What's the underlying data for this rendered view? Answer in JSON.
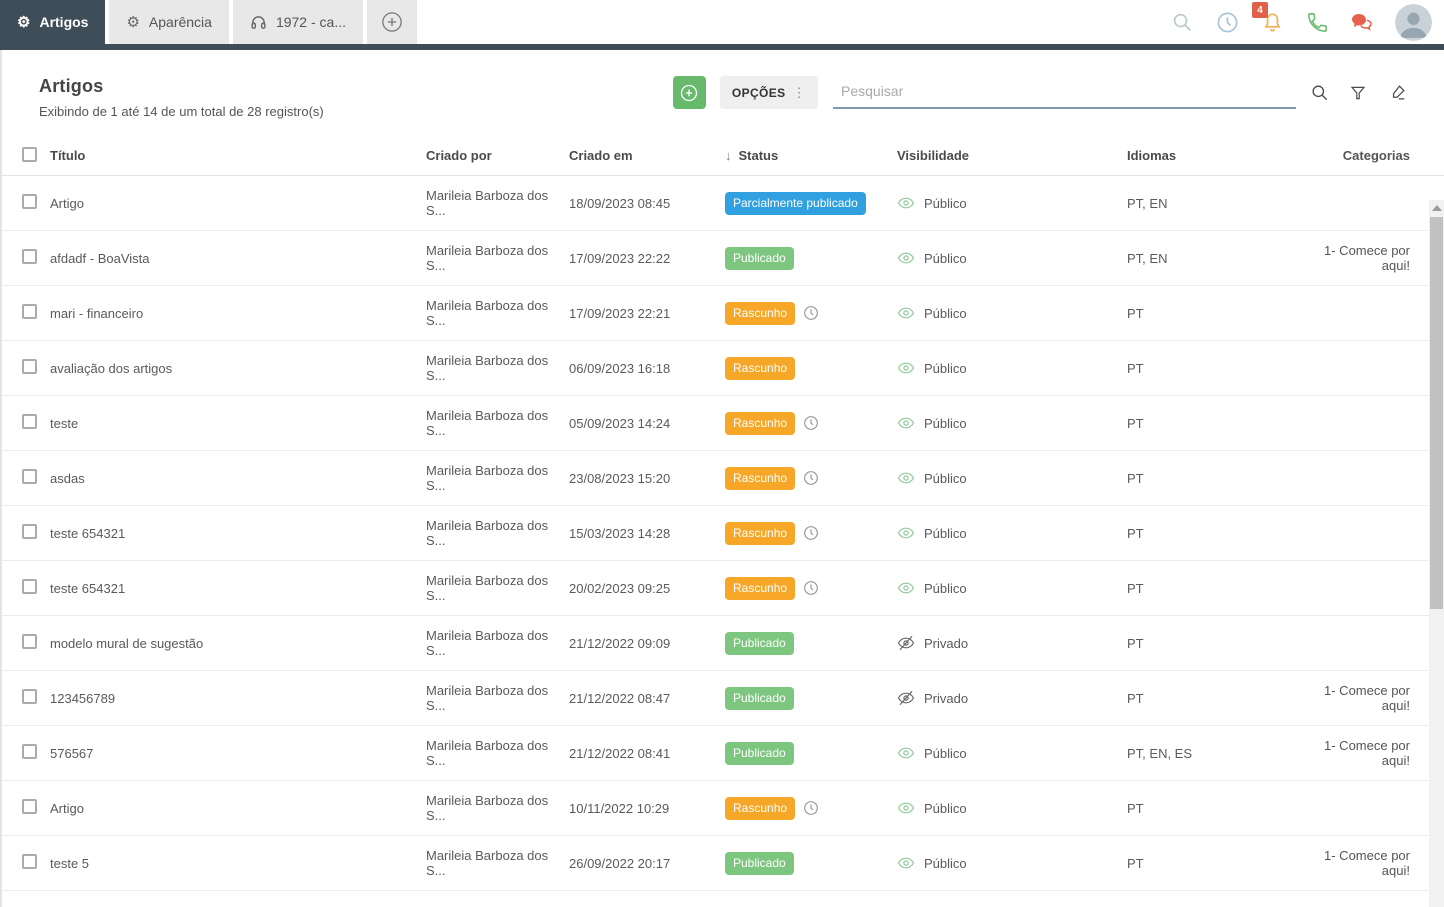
{
  "topbar": {
    "tabs": [
      {
        "label": "Artigos",
        "icon": "gear",
        "active": true
      },
      {
        "label": "Aparência",
        "icon": "gear",
        "active": false
      },
      {
        "label": "1972 - ca...",
        "icon": "headset",
        "active": false
      }
    ],
    "notification_count": "4",
    "icons": [
      "search-icon",
      "clock-icon",
      "bell-icon",
      "phone-icon",
      "chat-icon",
      "avatar"
    ]
  },
  "header": {
    "title": "Artigos",
    "subtitle": "Exibindo de 1 até 14 de um total de 28 registro(s)",
    "options_label": "OPÇÕES",
    "search_placeholder": "Pesquisar",
    "toolbar_icons": [
      "add-button",
      "options-button",
      "search-icon",
      "filter-icon",
      "clear-filter-icon"
    ]
  },
  "table": {
    "columns": {
      "titulo": "Título",
      "criado_por": "Criado por",
      "criado_em": "Criado em",
      "status": "Status",
      "visibilidade": "Visibilidade",
      "idiomas": "Idiomas",
      "categorias": "Categorias"
    },
    "sorted_column": "Status",
    "sort_direction": "desc",
    "rows": [
      {
        "titulo": "Artigo",
        "criado_por": "Marileia Barboza dos S...",
        "criado_em": "18/09/2023 08:45",
        "status": "Parcialmente publicado",
        "status_type": "partial",
        "clock": false,
        "visibilidade": "Público",
        "idiomas": "PT, EN",
        "categorias": ""
      },
      {
        "titulo": "afdadf - BoaVista",
        "criado_por": "Marileia Barboza dos S...",
        "criado_em": "17/09/2023 22:22",
        "status": "Publicado",
        "status_type": "published",
        "clock": false,
        "visibilidade": "Público",
        "idiomas": "PT, EN",
        "categorias": "1- Comece por aqui!"
      },
      {
        "titulo": "mari - financeiro",
        "criado_por": "Marileia Barboza dos S...",
        "criado_em": "17/09/2023 22:21",
        "status": "Rascunho",
        "status_type": "draft",
        "clock": true,
        "visibilidade": "Público",
        "idiomas": "PT",
        "categorias": ""
      },
      {
        "titulo": "avaliação dos artigos",
        "criado_por": "Marileia Barboza dos S...",
        "criado_em": "06/09/2023 16:18",
        "status": "Rascunho",
        "status_type": "draft",
        "clock": false,
        "visibilidade": "Público",
        "idiomas": "PT",
        "categorias": ""
      },
      {
        "titulo": "teste",
        "criado_por": "Marileia Barboza dos S...",
        "criado_em": "05/09/2023 14:24",
        "status": "Rascunho",
        "status_type": "draft",
        "clock": true,
        "visibilidade": "Público",
        "idiomas": "PT",
        "categorias": ""
      },
      {
        "titulo": "asdas",
        "criado_por": "Marileia Barboza dos S...",
        "criado_em": "23/08/2023 15:20",
        "status": "Rascunho",
        "status_type": "draft",
        "clock": true,
        "visibilidade": "Público",
        "idiomas": "PT",
        "categorias": ""
      },
      {
        "titulo": "teste 654321",
        "criado_por": "Marileia Barboza dos S...",
        "criado_em": "15/03/2023 14:28",
        "status": "Rascunho",
        "status_type": "draft",
        "clock": true,
        "visibilidade": "Público",
        "idiomas": "PT",
        "categorias": ""
      },
      {
        "titulo": "teste 654321",
        "criado_por": "Marileia Barboza dos S...",
        "criado_em": "20/02/2023 09:25",
        "status": "Rascunho",
        "status_type": "draft",
        "clock": true,
        "visibilidade": "Público",
        "idiomas": "PT",
        "categorias": ""
      },
      {
        "titulo": "modelo mural de sugestão",
        "criado_por": "Marileia Barboza dos S...",
        "criado_em": "21/12/2022 09:09",
        "status": "Publicado",
        "status_type": "published",
        "clock": false,
        "visibilidade": "Privado",
        "idiomas": "PT",
        "categorias": ""
      },
      {
        "titulo": "123456789",
        "criado_por": "Marileia Barboza dos S...",
        "criado_em": "21/12/2022 08:47",
        "status": "Publicado",
        "status_type": "published",
        "clock": false,
        "visibilidade": "Privado",
        "idiomas": "PT",
        "categorias": "1- Comece por aqui!"
      },
      {
        "titulo": "576567",
        "criado_por": "Marileia Barboza dos S...",
        "criado_em": "21/12/2022 08:41",
        "status": "Publicado",
        "status_type": "published",
        "clock": false,
        "visibilidade": "Público",
        "idiomas": "PT, EN, ES",
        "categorias": "1- Comece por aqui!"
      },
      {
        "titulo": "Artigo",
        "criado_por": "Marileia Barboza dos S...",
        "criado_em": "10/11/2022 10:29",
        "status": "Rascunho",
        "status_type": "draft",
        "clock": true,
        "visibilidade": "Público",
        "idiomas": "PT",
        "categorias": ""
      },
      {
        "titulo": "teste 5",
        "criado_por": "Marileia Barboza dos S...",
        "criado_em": "26/09/2022 20:17",
        "status": "Publicado",
        "status_type": "published",
        "clock": false,
        "visibilidade": "Público",
        "idiomas": "PT",
        "categorias": "1- Comece por aqui!"
      }
    ]
  },
  "colors": {
    "topbar_navy": "#3e4d58",
    "tab_inactive_bg": "#e8e8e8",
    "add_button_green": "#67ba6b",
    "badge_partial_blue": "#31a0e0",
    "badge_published_green": "#7cc67f",
    "badge_draft_orange": "#f6a727",
    "notification_red": "#e0604a",
    "bell_orange": "#f0ad4e",
    "phone_green": "#6fbf73",
    "chat_coral": "#e8604c",
    "eye_public_green": "#8fc795",
    "search_underline": "#7e99aa"
  }
}
